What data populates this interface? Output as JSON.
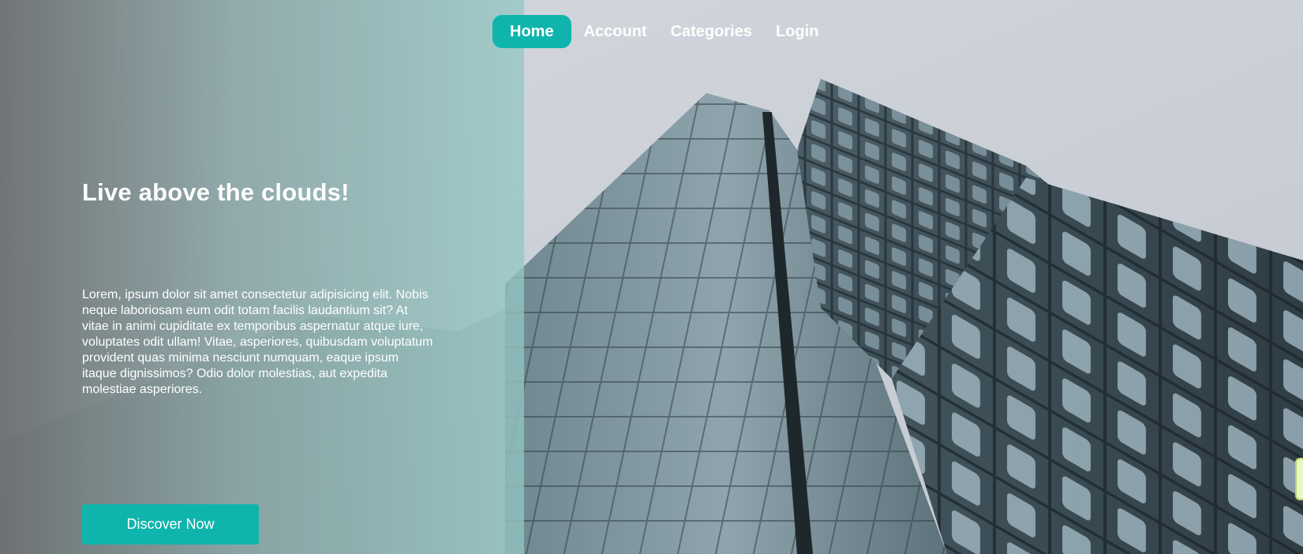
{
  "nav": {
    "items": [
      {
        "label": "Home",
        "active": true
      },
      {
        "label": "Account",
        "active": false
      },
      {
        "label": "Categories",
        "active": false
      },
      {
        "label": "Login",
        "active": false
      }
    ]
  },
  "hero": {
    "headline": "Live above the clouds!",
    "body": "Lorem, ipsum dolor sit amet consectetur adipisicing elit. Nobis neque laboriosam eum odit totam facilis laudantium sit? At vitae in animi cupiditate ex temporibus aspernatur atque iure, voluptates odit ullam! Vitae, asperiores, quibusdam voluptatum provident quas minima nesciunt numquam, eaque ipsum itaque dignissimos? Odio dolor molestias, aut expedita molestiae asperiores.",
    "cta_label": "Discover Now"
  },
  "colors": {
    "accent": "#0fb5ac",
    "text": "#ffffff"
  }
}
